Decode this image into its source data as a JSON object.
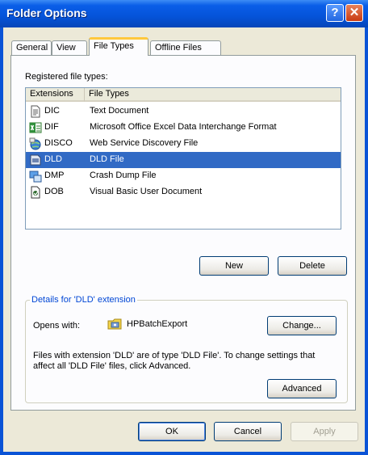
{
  "window": {
    "title": "Folder Options",
    "help_symbol": "?",
    "close_symbol": "✕"
  },
  "tabs": [
    {
      "label": "General",
      "active": false
    },
    {
      "label": "View",
      "active": false
    },
    {
      "label": "File Types",
      "active": true
    },
    {
      "label": "Offline Files",
      "active": false
    }
  ],
  "file_types": {
    "label": "Registered file types:",
    "columns": [
      "Extensions",
      "File Types"
    ],
    "rows": [
      {
        "ext": "DIC",
        "type": "Text Document",
        "icon": "text-document-icon",
        "selected": false
      },
      {
        "ext": "DIF",
        "type": "Microsoft Office Excel Data Interchange Format",
        "icon": "excel-icon",
        "selected": false
      },
      {
        "ext": "DISCO",
        "type": "Web Service Discovery File",
        "icon": "web-service-icon",
        "selected": false
      },
      {
        "ext": "DLD",
        "type": "DLD File",
        "icon": "dld-file-icon",
        "selected": true
      },
      {
        "ext": "DMP",
        "type": "Crash Dump File",
        "icon": "crash-dump-icon",
        "selected": false
      },
      {
        "ext": "DOB",
        "type": "Visual Basic User Document",
        "icon": "vb-document-icon",
        "selected": false
      }
    ],
    "new_label": "New",
    "delete_label": "Delete"
  },
  "details": {
    "title": "Details for 'DLD' extension",
    "opens_with_label": "Opens with:",
    "app_name": "HPBatchExport",
    "change_label": "Change...",
    "description": "Files with extension 'DLD' are of type 'DLD File'.  To change settings that affect all 'DLD File' files, click Advanced.",
    "advanced_label": "Advanced"
  },
  "footer": {
    "ok_label": "OK",
    "cancel_label": "Cancel",
    "apply_label": "Apply"
  },
  "colors": {
    "title_bar": "#0553d9",
    "selection": "#316ac5",
    "group_title": "#0046d5",
    "active_tab_accent": "#ffc83c"
  }
}
